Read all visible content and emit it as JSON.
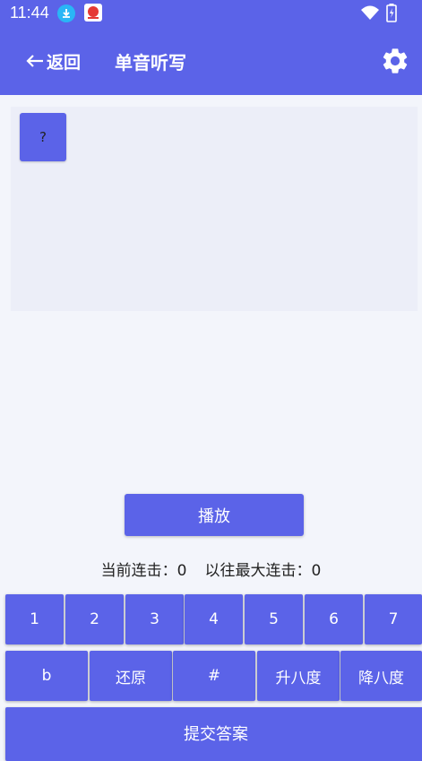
{
  "status_bar": {
    "time": "11:44",
    "icons": [
      "download-icon",
      "app-notification-icon",
      "wifi-icon",
      "battery-icon"
    ]
  },
  "app_bar": {
    "back_label": "返回",
    "title": "单音听写",
    "settings_icon": "gear-icon"
  },
  "note_panel": {
    "notes": [
      "?"
    ]
  },
  "play_button": "播放",
  "streak": {
    "current_label": "当前连击：",
    "current_value": "0",
    "max_label": "以往最大连击：",
    "max_value": "0"
  },
  "keypad": {
    "numbers": [
      "1",
      "2",
      "3",
      "4",
      "5",
      "6",
      "7"
    ],
    "modifiers": [
      "b",
      "还原",
      "#",
      "升八度",
      "降八度"
    ]
  },
  "submit_button": "提交答案",
  "colors": {
    "primary": "#5b63e8",
    "background": "#f3f5fb",
    "panel": "#eceef8"
  }
}
